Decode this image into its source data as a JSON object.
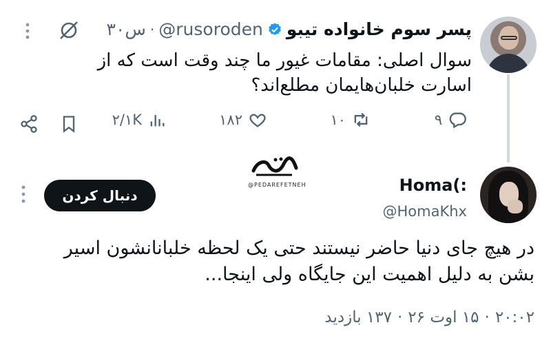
{
  "tweet1": {
    "display_name": "پسر سوم خانواده تیبو",
    "handle": "@rusoroden",
    "time": "۳۰س",
    "text": "سوال اصلی: مقامات غیور ما چند وقت است که از اسارت خلبان‌هایمان مطلع‌اند؟",
    "actions": {
      "replies": "۹",
      "reposts": "۱۰",
      "likes": "۱۸۲",
      "views": "۲/۱K"
    }
  },
  "watermark": {
    "caption": "@PEDAREFETNEH"
  },
  "tweet2": {
    "display_name": "Homa(:",
    "handle": "@HomaKhx",
    "follow_label": "دنبال کردن",
    "text": "در هیچ جای دنیا حاضر نیستند حتی یک لحظه خلبانانشون اسیر بشن به دلیل اهمیت این جایگاه ولی اینجا...",
    "time": "۲۰:۰۲",
    "date": "۱۵ اوت ۲۶",
    "views": "۱۳۷ بازدید"
  },
  "colors": {
    "verified": "#1d9bf0",
    "muted": "#536471",
    "text": "#0f1419",
    "thread_line": "#cfd9de"
  },
  "icons": [
    "more-icon",
    "grok-icon",
    "verified-icon",
    "reply-icon",
    "repost-icon",
    "like-icon",
    "views-icon",
    "bookmark-icon",
    "share-icon"
  ]
}
